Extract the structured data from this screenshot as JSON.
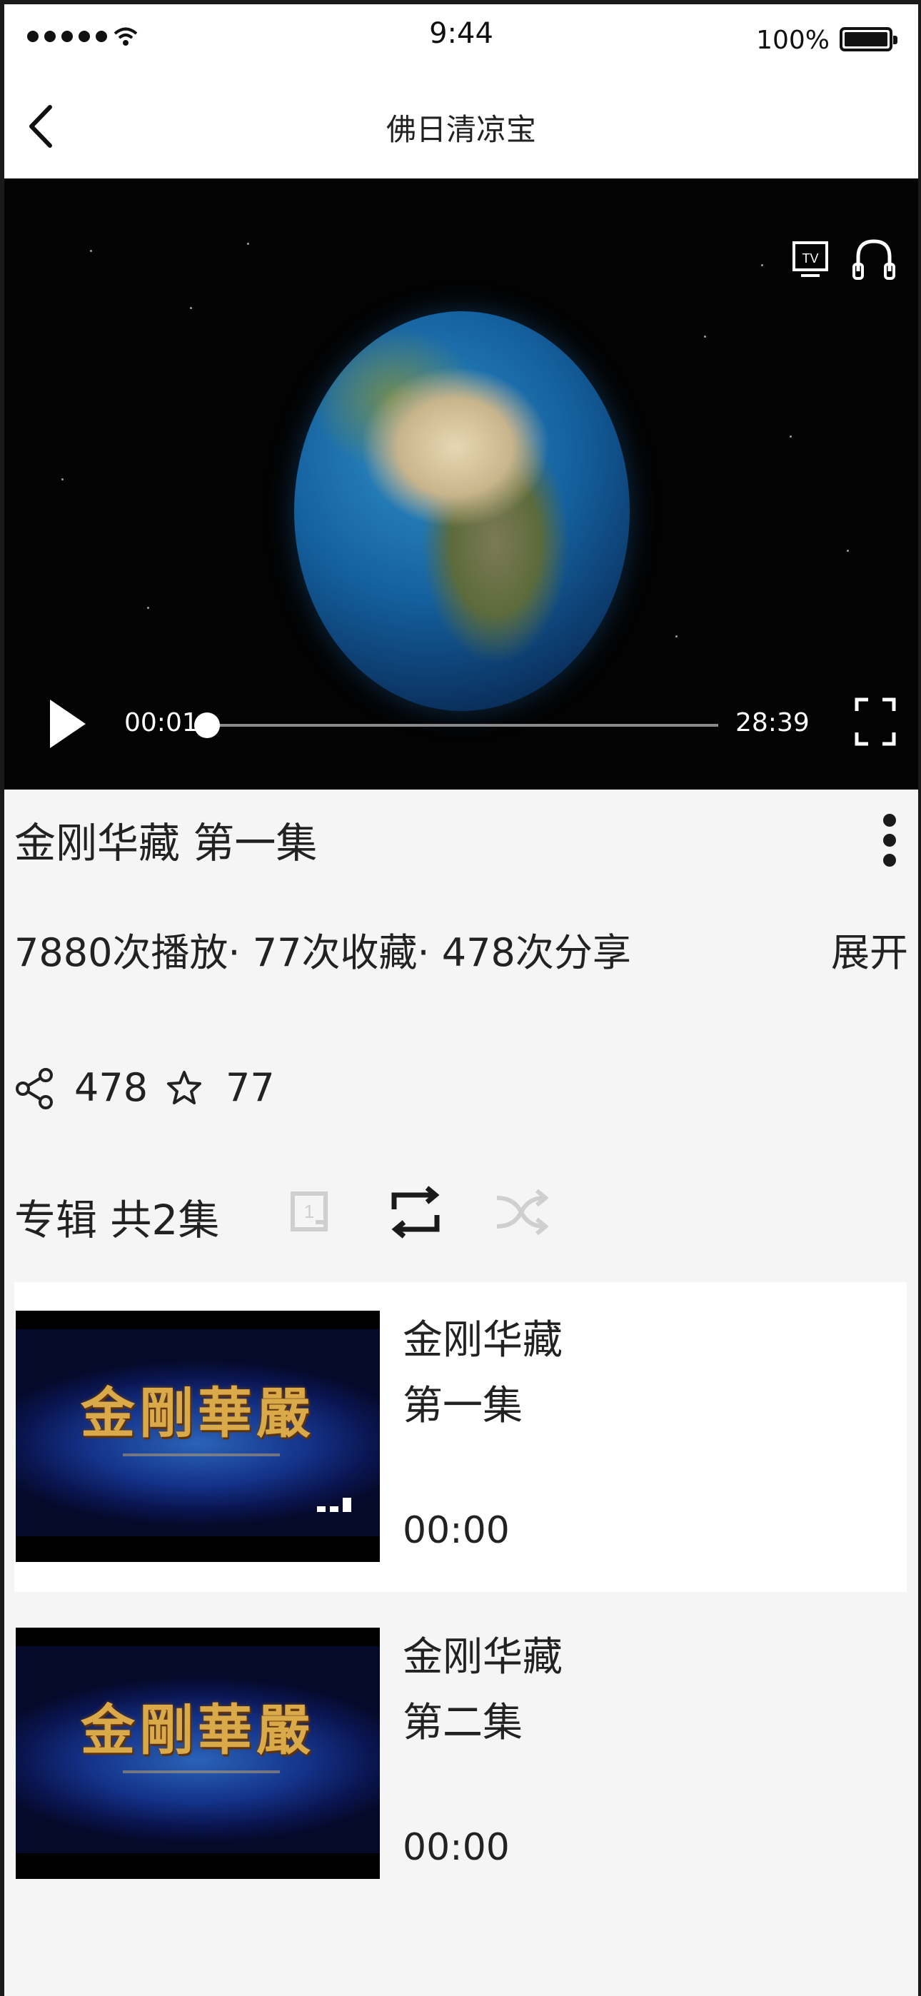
{
  "status_bar": {
    "time": "9:44",
    "battery": "100%"
  },
  "nav": {
    "title": "佛日清凉宝"
  },
  "player": {
    "current_time": "00:01",
    "total_time": "28:39",
    "progress": 0.0006
  },
  "video": {
    "title": "金刚华藏  第一集",
    "stats": "7880次播放· 77次收藏· 478次分享",
    "expand_label": "展开",
    "share_count": "478",
    "favorite_count": "77"
  },
  "album": {
    "label": "专辑  共2集"
  },
  "episodes": [
    {
      "name": "金刚华藏",
      "number": "第一集",
      "duration": "00:00",
      "thumbnail_text": "金剛華嚴"
    },
    {
      "name": "金刚华藏",
      "number": "第二集",
      "duration": "00:00",
      "thumbnail_text": "金剛華嚴"
    }
  ],
  "colors": {
    "accent_text": "#222222",
    "video_bg": "#030303",
    "thumb_gold": "#d9a94a",
    "disabled_icon": "#cfcfcf"
  }
}
